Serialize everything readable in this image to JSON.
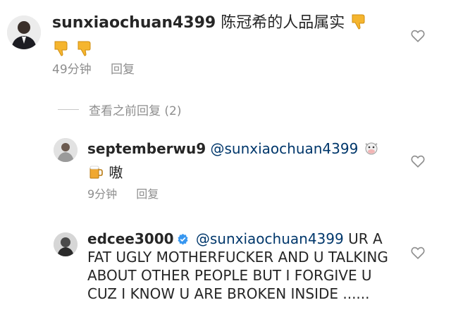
{
  "comment1": {
    "username": "sunxiaochuan4399",
    "text": "陈冠希的人品属实",
    "emoji_icons": [
      "thumbs-down-icon",
      "thumbs-down-icon",
      "thumbs-down-icon"
    ],
    "time": "49分钟",
    "reply_label": "回复"
  },
  "view_previous": {
    "label": "查看之前回复 (2)"
  },
  "comment2": {
    "username": "septemberwu9",
    "mention": "@sunxiaochuan4399",
    "emoji_icons": [
      "cow-face-icon",
      "beer-mug-icon"
    ],
    "text": "嗷",
    "time": "9分钟",
    "reply_label": "回复"
  },
  "comment3": {
    "username": "edcee3000",
    "verified": true,
    "mention": "@sunxiaochuan4399",
    "text": "UR A FAT UGLY MOTHERFUCKER AND U TALKING ABOUT OTHER PEOPLE BUT I FORGIVE U CUZ I KNOW U ARE BROKEN INSIDE ......"
  },
  "colors": {
    "text": "#262626",
    "muted": "#8e8e8e",
    "mention": "#00376b",
    "verified": "#3897f0",
    "thumb": "#f5b52e"
  }
}
